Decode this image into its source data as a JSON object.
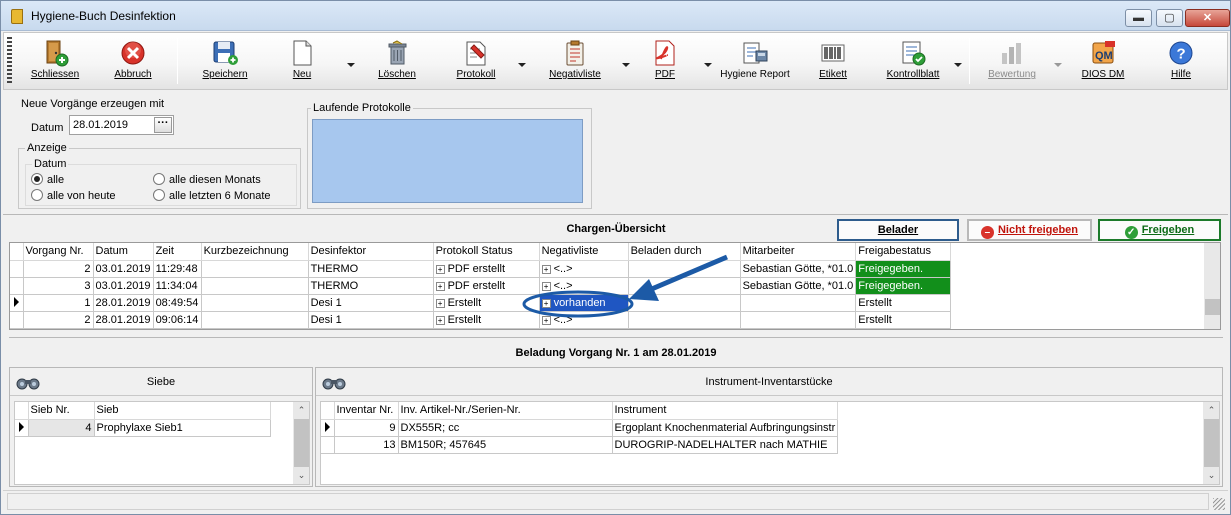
{
  "window": {
    "title": "Hygiene-Buch Desinfektion",
    "minimize": "▬",
    "maximize": "▢",
    "close": "✕"
  },
  "toolbar": {
    "schliessen": "Schliessen",
    "abbruch": "Abbruch",
    "speichern": "Speichern",
    "neu": "Neu",
    "loeschen": "Löschen",
    "protokoll": "Protokoll",
    "negativliste": "Negativliste",
    "pdf": "PDF",
    "hygiene_report": "Hygiene Report",
    "etikett": "Etikett",
    "kontrollblatt": "Kontrollblatt",
    "bewertung": "Bewertung",
    "dios_dm": "DIOS DM",
    "hilfe": "Hilfe"
  },
  "neue_vorgaenge": {
    "label": "Neue Vorgänge erzeugen mit",
    "datum_label": "Datum",
    "datum_value": "28.01.2019",
    "picker": "···"
  },
  "anzeige": {
    "label": "Anzeige",
    "datum_label": "Datum",
    "options": {
      "alle": "alle",
      "heute": "alle von heute",
      "monat": "alle diesen Monats",
      "sechs": "alle letzten 6 Monate"
    },
    "selected": "alle"
  },
  "laufende_protokolle": {
    "label": "Laufende Protokolle"
  },
  "chargen": {
    "title": "Chargen-Übersicht",
    "btn_belader": "Belader",
    "btn_nicht_freigeben": "Nicht freigeben",
    "btn_freigeben": "Freigeben",
    "columns": [
      "Vorgang Nr.",
      "Datum",
      "Zeit",
      "Kurzbezeichnung",
      "Desinfektor",
      "Protokoll Status",
      "Negativliste",
      "Beladen durch",
      "Mitarbeiter",
      "Freigabestatus"
    ],
    "rows": [
      {
        "nr": "2",
        "datum": "03.01.2019",
        "zeit": "11:29:48",
        "kurz": "",
        "desinfektor": "THERMO",
        "protokoll": "PDF erstellt",
        "negativ": "<..>",
        "beladen": "",
        "mitarbeiter": "Sebastian Götte, *01.0",
        "freigabe": "Freigegeben."
      },
      {
        "nr": "3",
        "datum": "03.01.2019",
        "zeit": "11:34:04",
        "kurz": "",
        "desinfektor": "THERMO",
        "protokoll": "PDF erstellt",
        "negativ": "<..>",
        "beladen": "",
        "mitarbeiter": "Sebastian Götte, *01.0",
        "freigabe": "Freigegeben."
      },
      {
        "nr": "1",
        "datum": "28.01.2019",
        "zeit": "08:49:54",
        "kurz": "",
        "desinfektor": "Desi 1",
        "protokoll": "Erstellt",
        "negativ": "vorhanden",
        "beladen": "",
        "mitarbeiter": "",
        "freigabe": "Erstellt"
      },
      {
        "nr": "2",
        "datum": "28.01.2019",
        "zeit": "09:06:14",
        "kurz": "",
        "desinfektor": "Desi 1",
        "protokoll": "Erstellt",
        "negativ": "<..>",
        "beladen": "",
        "mitarbeiter": "",
        "freigabe": "Erstellt"
      }
    ]
  },
  "beladung": {
    "title": "Beladung Vorgang Nr. 1 am 28.01.2019"
  },
  "siebe": {
    "title": "Siebe",
    "columns": [
      "Sieb Nr.",
      "Sieb"
    ],
    "rows": [
      {
        "nr": "4",
        "name": "Prophylaxe Sieb1"
      }
    ]
  },
  "instrumente": {
    "title": "Instrument-Inventarstücke",
    "columns": [
      "Inventar Nr.",
      "Inv. Artikel-Nr./Serien-Nr.",
      "Instrument"
    ],
    "rows": [
      {
        "nr": "9",
        "artikel": "DX555R; cc",
        "instrument": "Ergoplant Knochenmaterial Aufbringungsinstr"
      },
      {
        "nr": "13",
        "artikel": "BM150R; 457645",
        "instrument": "DUROGRIP-NADELHALTER nach MATHIE"
      }
    ]
  },
  "colors": {
    "selection": "#1f56c2",
    "released": "#128f1b",
    "annotation": "#1c5aa6",
    "protocols_bg": "#a7c7ee"
  }
}
